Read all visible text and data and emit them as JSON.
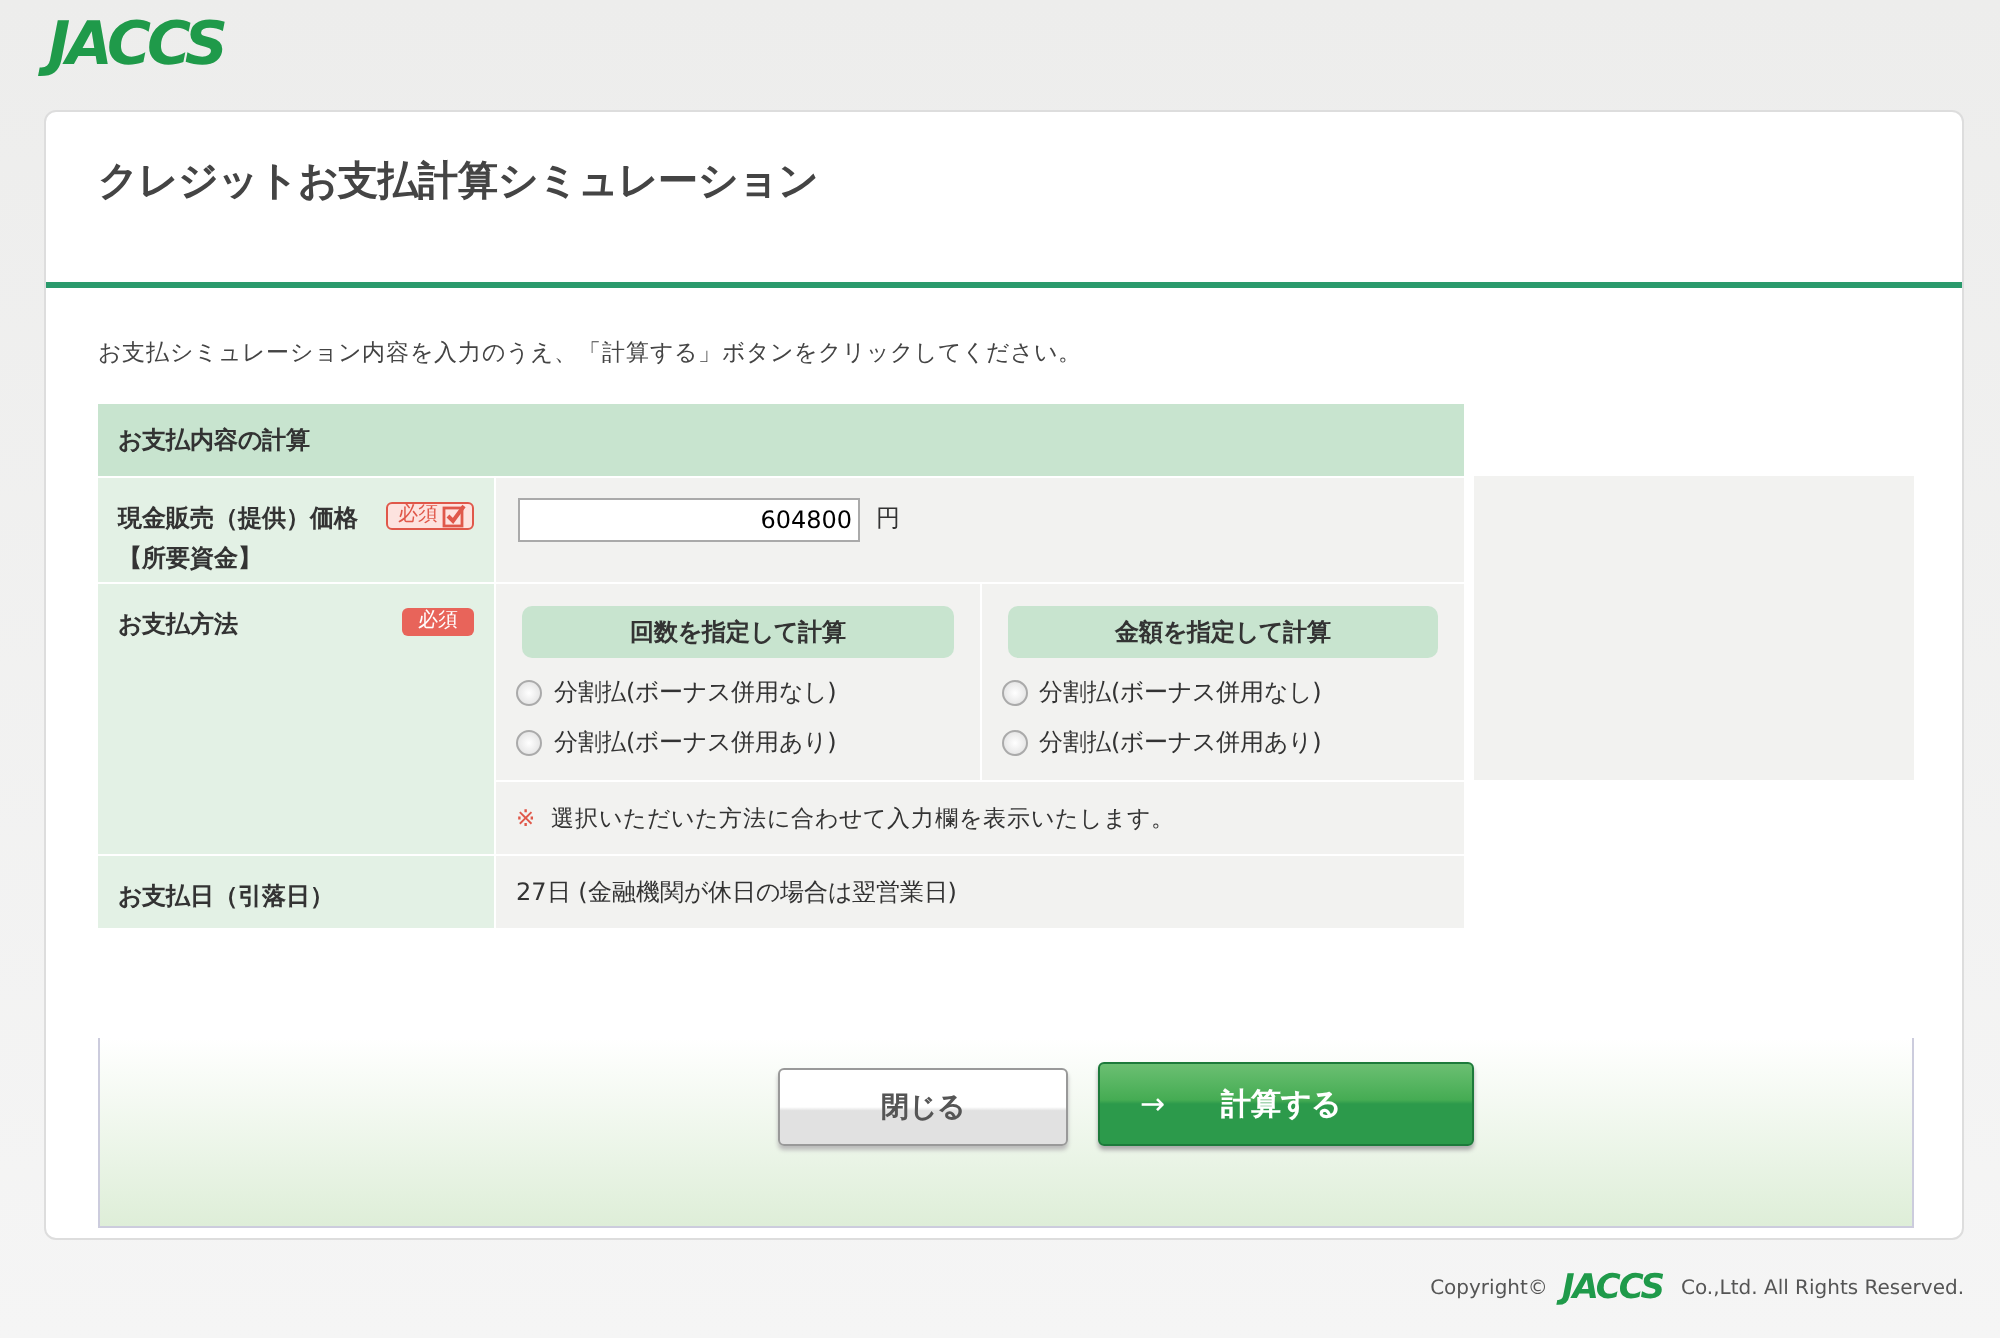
{
  "logo": "JACCS",
  "title": "クレジットお支払計算シミュレーション",
  "intro": "お支払シミュレーション内容を入力のうえ、「計算する」ボタンをクリックしてください。",
  "section": {
    "heading": "お支払内容の計算"
  },
  "rows": [
    {
      "kind": "price",
      "label": "現金販売（提供）価格",
      "sublabel": "【所要資金】",
      "badge": {
        "text": "必須",
        "done": true
      },
      "value": "604800",
      "unit": "円"
    },
    {
      "kind": "method",
      "label": "お支払方法",
      "badge": {
        "text": "必須",
        "done": false
      },
      "groups": [
        {
          "heading": "回数を指定して計算",
          "options": [
            {
              "label": "分割払(ボーナス併用なし)",
              "selected": false
            },
            {
              "label": "分割払(ボーナス併用あり)",
              "selected": false
            }
          ]
        },
        {
          "heading": "金額を指定して計算",
          "options": [
            {
              "label": "分割払(ボーナス併用なし)",
              "selected": false
            },
            {
              "label": "分割払(ボーナス併用あり)",
              "selected": false
            }
          ]
        }
      ],
      "note_mark": "※",
      "note": "選択いただいた方法に合わせて入力欄を表示いたします。"
    },
    {
      "kind": "date",
      "label": "お支払日（引落日）",
      "value": "27日 (金融機関が休日の場合は翌営業日)"
    }
  ],
  "buttons": [
    {
      "kind": "secondary",
      "label": "閉じる"
    },
    {
      "kind": "primary",
      "icon": "→",
      "label": "計算する"
    }
  ],
  "footer": {
    "prefix": "Copyright©",
    "logo": "JACCS",
    "suffix": "Co.,Ltd. All Rights Reserved."
  }
}
